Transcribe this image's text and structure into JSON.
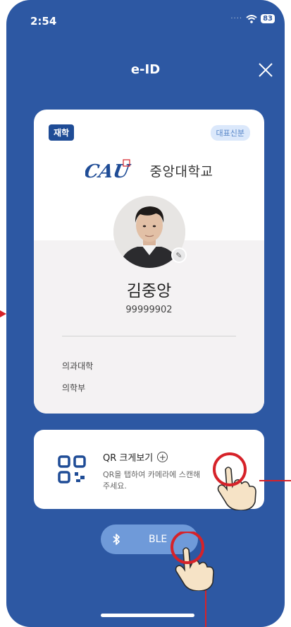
{
  "status_bar": {
    "time": "2:54",
    "battery": "83"
  },
  "header": {
    "title": "e-ID"
  },
  "card": {
    "status_badge": "재학",
    "representative_badge": "대표신분",
    "university_name": "중앙대학교",
    "name": "김중앙",
    "student_id": "99999902",
    "college": "의과대학",
    "department": "의학부"
  },
  "qr": {
    "title": "QR 크게보기",
    "description": "QR을 탭하여 카메라에 스캔해주세요."
  },
  "ble": {
    "label": "BLE"
  },
  "colors": {
    "background": "#2d58a3",
    "accent": "#1f4c96",
    "annotation": "#d62229"
  }
}
